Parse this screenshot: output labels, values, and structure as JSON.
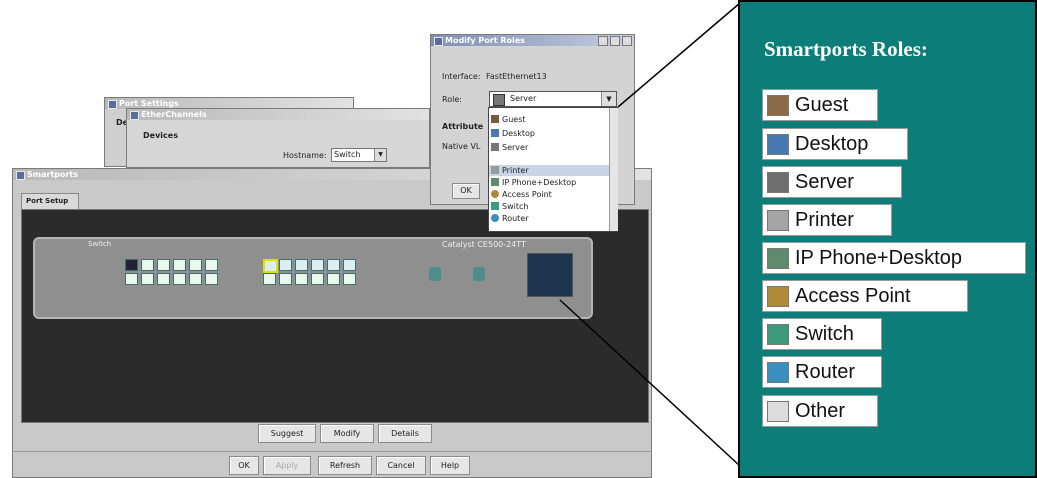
{
  "windows": {
    "port_settings_title": "Port Settings",
    "port_settings_tab": "De",
    "etherchannels_title": "EtherChannels",
    "devices_label": "Devices",
    "hostname_label": "Hostname:",
    "hostname_value": "Switch",
    "smartports_title": "Smartports",
    "tab_port_setup": "Port Setup"
  },
  "switch": {
    "label": "Switch",
    "model": "Catalyst CE500-24TT"
  },
  "smartports_buttons": {
    "suggest": "Suggest",
    "modify": "Modify",
    "details": "Details"
  },
  "bottom_buttons": {
    "ok": "OK",
    "apply": "Apply",
    "refresh": "Refresh",
    "cancel": "Cancel",
    "help": "Help"
  },
  "modify_dialog": {
    "title": "Modify Port Roles",
    "interface_label": "Interface:",
    "interface_value": "FastEthernet13",
    "role_label": "Role:",
    "role_value": "Server",
    "attributes_label": "Attribute",
    "native_vlan_label": "Native VL",
    "ok_button": "OK",
    "dropdown_items": [
      "Guest",
      "Desktop",
      "Server",
      "Printer",
      "IP Phone+Desktop",
      "Access Point",
      "Switch",
      "Router"
    ],
    "selected_item": "Printer"
  },
  "callout": {
    "title": "Smartports Roles:",
    "roles": [
      "Guest",
      "Desktop",
      "Server",
      "Printer",
      "IP Phone+Desktop",
      "Access Point",
      "Switch",
      "Router",
      "Other"
    ]
  },
  "colors": {
    "panel_bg": "#0c7d78",
    "window_bg": "#cfcfcf",
    "title_active": "#7f8fb4"
  }
}
